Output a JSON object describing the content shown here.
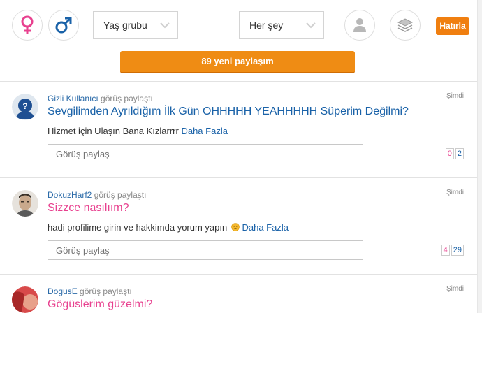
{
  "toolbar": {
    "female_icon": "female-symbol",
    "male_icon": "male-symbol",
    "age_select": "Yaş grubu",
    "type_select": "Her şey",
    "remind_label": "Hatırla",
    "new_posts": "89 yeni paylaşım"
  },
  "posts": [
    {
      "user": "Gizli Kullanıcı",
      "action": "görüş paylaştı",
      "time": "Şimdi",
      "title": "Sevgilimden Ayrıldığım İlk Gün OHHHHH YEAHHHHH Süperim Değilmi?",
      "body": "Hizmet için Ulaşın Bana Kızlarrrr",
      "more": "Daha Fazla",
      "placeholder": "Görüş paylaş",
      "count_pink": "0",
      "count_blue": "2"
    },
    {
      "user": "DokuzHarf2",
      "action": "görüş paylaştı",
      "time": "Şimdi",
      "title": "Sizzce nasılıım?",
      "body": "hadi profilime girin ve hakkimda yorum yapın",
      "more": "Daha Fazla",
      "placeholder": "Görüş paylaş",
      "count_pink": "4",
      "count_blue": "29"
    },
    {
      "user": "DogusE",
      "action": "görüş paylaştı",
      "time": "Şimdi",
      "title": "Gögüslerim güzelmi?"
    }
  ],
  "colors": {
    "accent_orange": "#ef8c14",
    "link_blue": "#1a62a8",
    "pink": "#e8418f"
  }
}
